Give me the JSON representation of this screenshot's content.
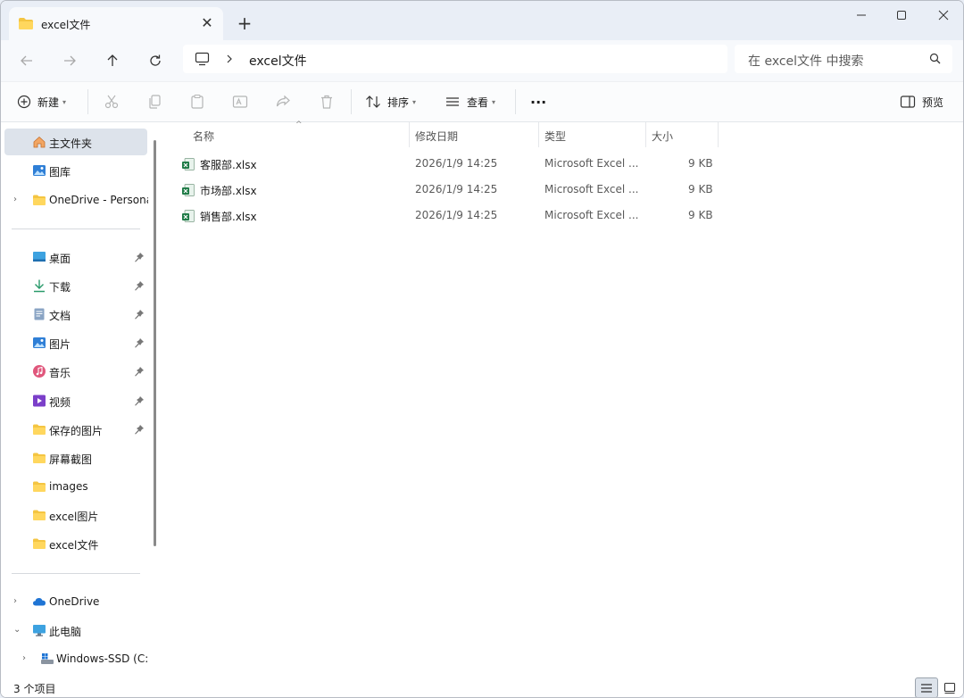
{
  "tab": {
    "title": "excel文件",
    "close": "✕",
    "new": "+"
  },
  "address": {
    "path": "excel文件"
  },
  "search": {
    "placeholder": "在 excel文件 中搜索"
  },
  "toolbar": {
    "new_label": "新建",
    "sort_label": "排序",
    "view_label": "查看",
    "more_label": "···",
    "preview_label": "预览"
  },
  "sidebar": {
    "home": "主文件夹",
    "gallery": "图库",
    "onedrive_personal": "OneDrive - Personal",
    "pinned": [
      {
        "label": "桌面"
      },
      {
        "label": "下载"
      },
      {
        "label": "文档"
      },
      {
        "label": "图片"
      },
      {
        "label": "音乐"
      },
      {
        "label": "视频"
      },
      {
        "label": "保存的图片"
      }
    ],
    "folders": [
      {
        "label": "屏幕截图"
      },
      {
        "label": "images"
      },
      {
        "label": "excel图片"
      },
      {
        "label": "excel文件"
      }
    ],
    "onedrive": "OneDrive",
    "this_pc": "此电脑",
    "windows_ssd": "Windows-SSD (C:)"
  },
  "columns": {
    "name": "名称",
    "modified": "修改日期",
    "type": "类型",
    "size": "大小"
  },
  "files": [
    {
      "name": "客服部.xlsx",
      "modified": "2026/1/9 14:25",
      "type": "Microsoft Excel ...",
      "size": "9 KB"
    },
    {
      "name": "市场部.xlsx",
      "modified": "2026/1/9 14:25",
      "type": "Microsoft Excel ...",
      "size": "9 KB"
    },
    {
      "name": "销售部.xlsx",
      "modified": "2026/1/9 14:25",
      "type": "Microsoft Excel ...",
      "size": "9 KB"
    }
  ],
  "status": {
    "count": "3 个项目"
  },
  "colors": {
    "accent": "#0067c0",
    "folder": "#f4c542",
    "excel": "#1d7a45"
  }
}
